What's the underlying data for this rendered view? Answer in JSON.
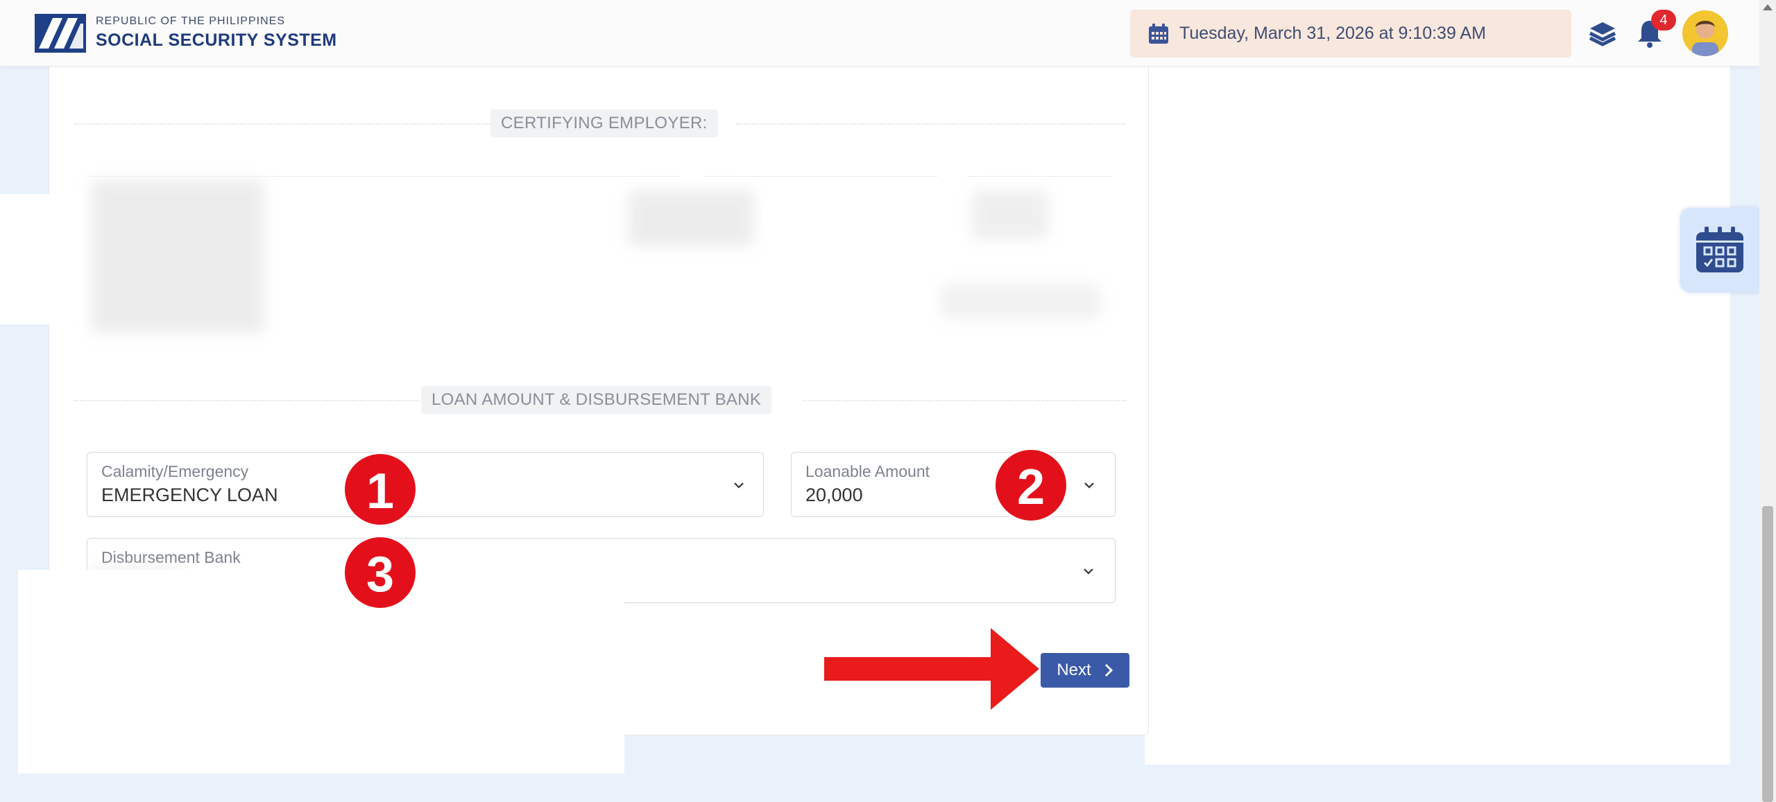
{
  "header": {
    "org_line1": "REPUBLIC OF THE PHILIPPINES",
    "org_line2": "SOCIAL SECURITY SYSTEM",
    "datetime": "Tuesday, March 31, 2026 at 9:10:39 AM",
    "notification_count": "4",
    "icons": [
      "calendar-icon",
      "layers-icon",
      "bell-icon",
      "user-avatar"
    ]
  },
  "sections": {
    "certifying_employer": "CERTIFYING EMPLOYER:",
    "loan_amount_bank": "LOAN AMOUNT & DISBURSEMENT BANK"
  },
  "fields": {
    "calamity": {
      "label": "Calamity/Emergency",
      "value": "EMERGENCY LOAN"
    },
    "loanable": {
      "label": "Loanable Amount",
      "value": "20,000"
    },
    "bank": {
      "label": "Disbursement Bank",
      "value": ""
    }
  },
  "annotations": {
    "step1": "1",
    "step2": "2",
    "step3": "3"
  },
  "actions": {
    "next_label": "Next"
  },
  "colors": {
    "brand_blue": "#1e3a7b",
    "button_blue": "#3a5aa8",
    "annotation_red": "#e3101b",
    "date_bg": "#f8e7dc"
  }
}
